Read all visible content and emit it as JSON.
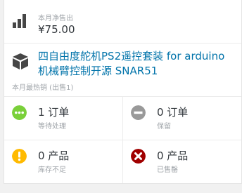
{
  "sales": {
    "label": "本月净售出",
    "value": "¥75.00",
    "icon": "bar-chart-icon"
  },
  "best_seller": {
    "name_line1": "四自由度舵机PS2遥控套装 for arduino",
    "name_line2": "机械臂控制开源 SNAR51",
    "sublabel": "本月最热销 (出售1)",
    "icon": "cube-icon"
  },
  "status": [
    {
      "value": "1 订单",
      "label": "等待处理",
      "icon": "more-dots-icon",
      "color": "#7ad03a"
    },
    {
      "value": "0 订单",
      "label": "保留",
      "icon": "minus-circle-icon",
      "color": "#999999"
    },
    {
      "value": "0 产品",
      "label": "库存不足",
      "icon": "warning-icon",
      "color": "#ffba00"
    },
    {
      "value": "0 产品",
      "label": "已售罄",
      "icon": "close-circle-icon",
      "color": "#a00000"
    }
  ]
}
